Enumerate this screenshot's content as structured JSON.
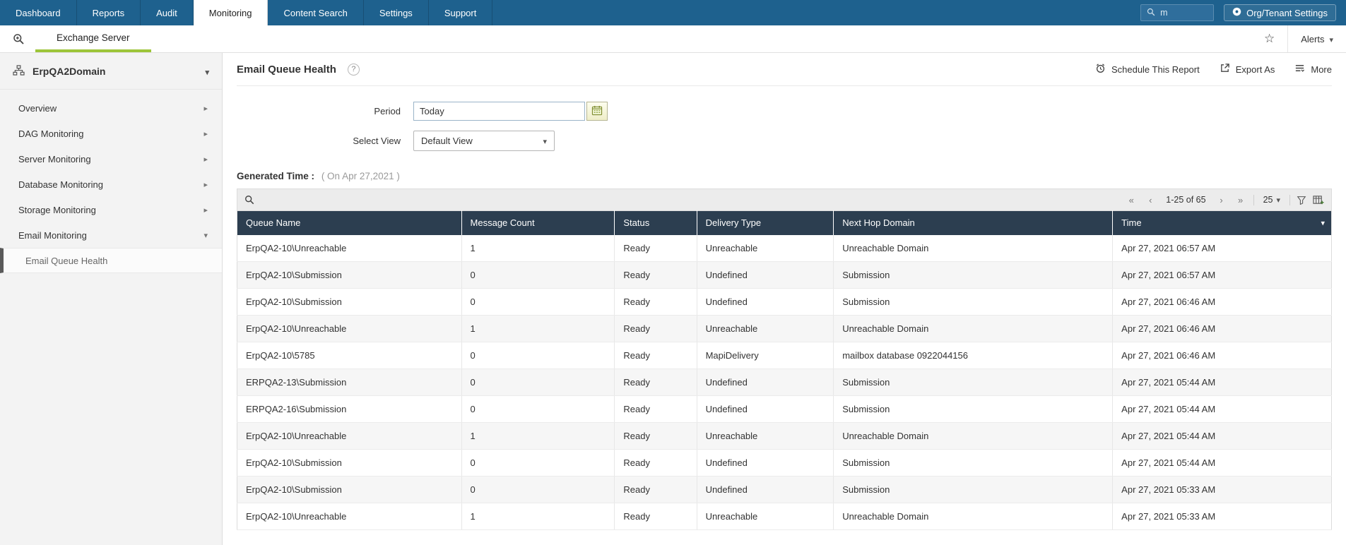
{
  "topnav": {
    "tabs": [
      "Dashboard",
      "Reports",
      "Audit",
      "Monitoring",
      "Content Search",
      "Settings",
      "Support"
    ],
    "active_tab": "Monitoring",
    "search_value": "m",
    "org_settings_label": "Org/Tenant Settings"
  },
  "subnav": {
    "module_tab": "Exchange Server",
    "alerts_label": "Alerts"
  },
  "sidebar": {
    "domain_label": "ErpQA2Domain",
    "items": [
      {
        "label": "Overview"
      },
      {
        "label": "DAG Monitoring"
      },
      {
        "label": "Server Monitoring"
      },
      {
        "label": "Database Monitoring"
      },
      {
        "label": "Storage Monitoring"
      },
      {
        "label": "Email Monitoring",
        "expanded": true
      }
    ],
    "subitems": [
      {
        "label": "Email Queue Health",
        "selected": true
      }
    ]
  },
  "main": {
    "title": "Email Queue Health",
    "help_icon": "?",
    "actions": {
      "schedule_label": "Schedule This Report",
      "export_label": "Export As",
      "more_label": "More"
    },
    "filters": {
      "period_label": "Period",
      "period_value": "Today",
      "view_label": "Select View",
      "view_value": "Default View"
    },
    "generated_label": "Generated Time :",
    "generated_value": "( On Apr 27,2021 )"
  },
  "table": {
    "pagination": {
      "first": "«",
      "prev": "‹",
      "range": "1-25 of 65",
      "next": "›",
      "last": "»",
      "page_size": "25"
    },
    "columns": [
      "Queue Name",
      "Message Count",
      "Status",
      "Delivery Type",
      "Next Hop Domain",
      "Time"
    ],
    "sorted_column": "Time",
    "sort_direction": "desc",
    "rows": [
      [
        "ErpQA2-10\\Unreachable",
        "1",
        "Ready",
        "Unreachable",
        "Unreachable Domain",
        "Apr 27, 2021 06:57 AM"
      ],
      [
        "ErpQA2-10\\Submission",
        "0",
        "Ready",
        "Undefined",
        "Submission",
        "Apr 27, 2021 06:57 AM"
      ],
      [
        "ErpQA2-10\\Submission",
        "0",
        "Ready",
        "Undefined",
        "Submission",
        "Apr 27, 2021 06:46 AM"
      ],
      [
        "ErpQA2-10\\Unreachable",
        "1",
        "Ready",
        "Unreachable",
        "Unreachable Domain",
        "Apr 27, 2021 06:46 AM"
      ],
      [
        "ErpQA2-10\\5785",
        "0",
        "Ready",
        "MapiDelivery",
        "mailbox database 0922044156",
        "Apr 27, 2021 06:46 AM"
      ],
      [
        "ERPQA2-13\\Submission",
        "0",
        "Ready",
        "Undefined",
        "Submission",
        "Apr 27, 2021 05:44 AM"
      ],
      [
        "ERPQA2-16\\Submission",
        "0",
        "Ready",
        "Undefined",
        "Submission",
        "Apr 27, 2021 05:44 AM"
      ],
      [
        "ErpQA2-10\\Unreachable",
        "1",
        "Ready",
        "Unreachable",
        "Unreachable Domain",
        "Apr 27, 2021 05:44 AM"
      ],
      [
        "ErpQA2-10\\Submission",
        "0",
        "Ready",
        "Undefined",
        "Submission",
        "Apr 27, 2021 05:44 AM"
      ],
      [
        "ErpQA2-10\\Submission",
        "0",
        "Ready",
        "Undefined",
        "Submission",
        "Apr 27, 2021 05:33 AM"
      ],
      [
        "ErpQA2-10\\Unreachable",
        "1",
        "Ready",
        "Unreachable",
        "Unreachable Domain",
        "Apr 27, 2021 05:33 AM"
      ]
    ]
  },
  "colors": {
    "topnav_bg": "#1E618E",
    "accent_green": "#9DC53A",
    "table_header_bg": "#2C3E50"
  }
}
